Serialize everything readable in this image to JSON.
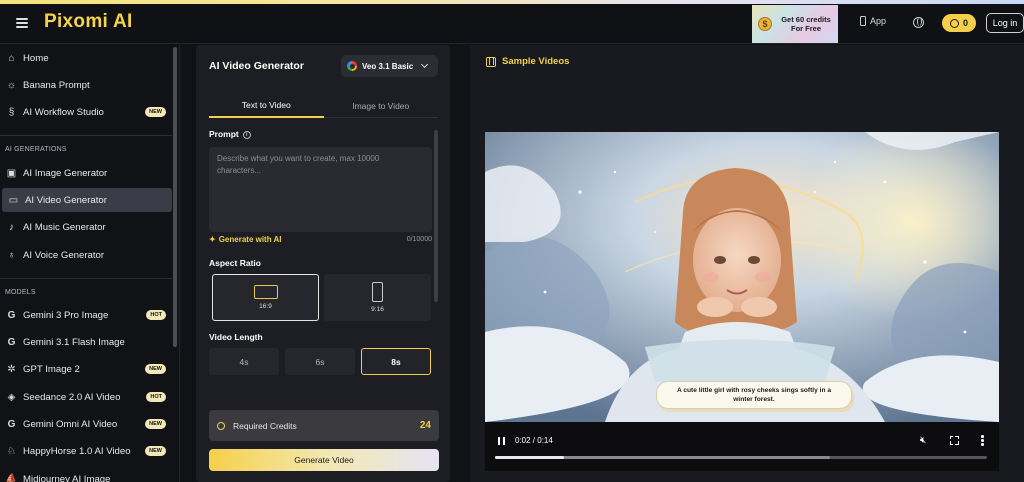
{
  "header": {
    "logo": "Pixomi AI",
    "promo": "Get 60 credits For Free",
    "app_label": "App",
    "credit_count": "0",
    "login_label": "Log in"
  },
  "sidebar": {
    "top_items": [
      {
        "label": "Home",
        "icon": "home-icon"
      },
      {
        "label": "Banana Prompt",
        "icon": "sun-icon"
      },
      {
        "label": "AI Workflow Studio",
        "icon": "workflow-icon",
        "badge": "NEW"
      }
    ],
    "generations_header": "AI GENERATIONS",
    "generation_items": [
      {
        "label": "AI Image Generator",
        "icon": "image-icon"
      },
      {
        "label": "AI Video Generator",
        "icon": "video-icon",
        "active": true
      },
      {
        "label": "AI Music Generator",
        "icon": "music-icon"
      },
      {
        "label": "AI Voice Generator",
        "icon": "mic-icon"
      }
    ],
    "models_header": "MODELS",
    "model_items": [
      {
        "label": "Gemini 3 Pro Image",
        "icon": "google-icon",
        "badge": "HOT"
      },
      {
        "label": "Gemini 3.1 Flash Image",
        "icon": "google-icon"
      },
      {
        "label": "GPT Image 2",
        "icon": "openai-icon",
        "badge": "NEW"
      },
      {
        "label": "Seedance 2.0 AI Video",
        "icon": "seedance-icon",
        "badge": "HOT"
      },
      {
        "label": "Gemini Omni AI Video",
        "icon": "google-icon",
        "badge": "NEW"
      },
      {
        "label": "HappyHorse 1.0 AI Video",
        "icon": "horse-icon",
        "badge": "NEW"
      },
      {
        "label": "Midjourney AI Image",
        "icon": "midjourney-icon"
      }
    ]
  },
  "generator": {
    "title": "AI Video Generator",
    "model": "Veo 3.1 Basic",
    "tabs": [
      "Text to Video",
      "Image to Video"
    ],
    "active_tab": 0,
    "prompt_label": "Prompt",
    "prompt_placeholder": "Describe what you want to create, max 10000 characters...",
    "generate_with_ai": "Generate with AI",
    "char_count": "0/10000",
    "aspect_label": "Aspect Ratio",
    "aspect_options": [
      "16:9",
      "9:16"
    ],
    "aspect_selected": "16:9",
    "length_label": "Video Length",
    "length_options": [
      "4s",
      "6s",
      "8s"
    ],
    "length_selected": "8s",
    "required_credits_label": "Required Credits",
    "required_credits": "24",
    "generate_button": "Generate Video"
  },
  "samples": {
    "title": "Sample Videos",
    "caption": "A cute little girl with rosy cheeks sings softly in a winter forest.",
    "time": "0:02 / 0:14",
    "progress": 0.14,
    "buffered": 0.68
  },
  "colors": {
    "accent": "#f3d04a",
    "background": "#111216",
    "panel": "#1d1e23"
  }
}
